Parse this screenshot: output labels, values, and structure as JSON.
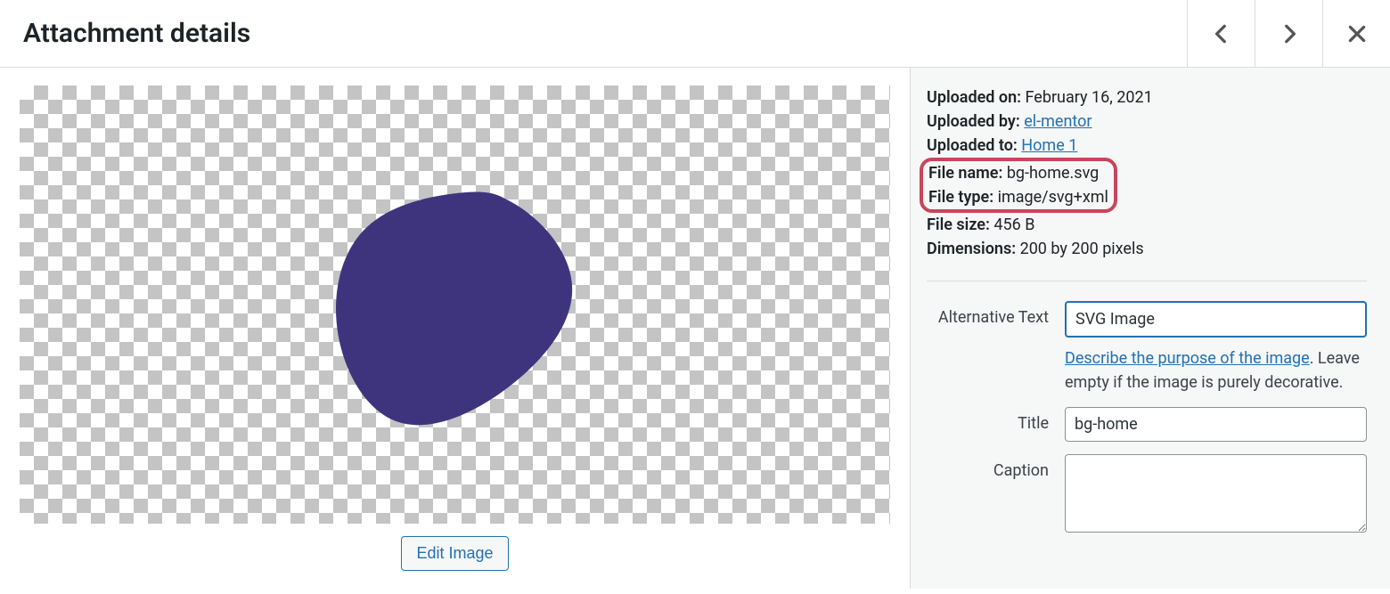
{
  "header": {
    "title": "Attachment details"
  },
  "media": {
    "edit_button": "Edit Image",
    "blob_color": "#3e347e"
  },
  "details": {
    "uploaded_on_label": "Uploaded on:",
    "uploaded_on_value": "February 16, 2021",
    "uploaded_by_label": "Uploaded by:",
    "uploaded_by_value": "el-mentor",
    "uploaded_to_label": "Uploaded to:",
    "uploaded_to_value": "Home 1",
    "file_name_label": "File name:",
    "file_name_value": "bg-home.svg",
    "file_type_label": "File type:",
    "file_type_value": "image/svg+xml",
    "file_size_label": "File size:",
    "file_size_value": "456 B",
    "dimensions_label": "Dimensions:",
    "dimensions_value": "200 by 200 pixels"
  },
  "form": {
    "alt_label": "Alternative Text",
    "alt_value": "SVG Image",
    "alt_help_link": "Describe the purpose of the image",
    "alt_help_text": ". Leave empty if the image is purely decorative.",
    "title_label": "Title",
    "title_value": "bg-home",
    "caption_label": "Caption",
    "caption_value": ""
  }
}
